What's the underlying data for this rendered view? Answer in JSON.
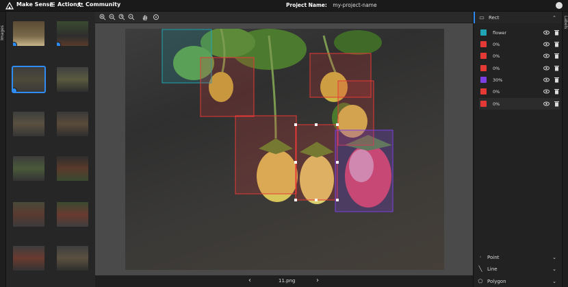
{
  "header": {
    "brand": "Make Sense",
    "nav": [
      {
        "label": "Actions",
        "icon": "actions-icon"
      },
      {
        "label": "Community",
        "icon": "community-icon"
      }
    ],
    "project_label": "Project Name:",
    "project_value": "my-project-name"
  },
  "left_panel": {
    "tab_label": "Images",
    "thumbnails": [
      {
        "checked": true,
        "selected": false
      },
      {
        "checked": true,
        "selected": false
      },
      {
        "checked": true,
        "selected": true
      },
      {
        "checked": false,
        "selected": false
      },
      {
        "checked": false,
        "selected": false
      },
      {
        "checked": false,
        "selected": false
      },
      {
        "checked": false,
        "selected": false
      },
      {
        "checked": false,
        "selected": false
      },
      {
        "checked": false,
        "selected": false
      },
      {
        "checked": false,
        "selected": false
      },
      {
        "checked": false,
        "selected": false
      },
      {
        "checked": false,
        "selected": false
      }
    ]
  },
  "toolbar": {
    "tools": [
      "zoom-in-icon",
      "zoom-out-icon",
      "zoom-fit-icon",
      "zoom-reset-icon",
      "hand-icon",
      "crosshair-icon"
    ]
  },
  "footer": {
    "filename": "11.png",
    "prev_icon": "chevron-left-icon",
    "next_icon": "chevron-right-icon"
  },
  "right_panel": {
    "tab_label": "Labels",
    "rect_section": {
      "title": "Rect",
      "labels": [
        {
          "text": "flower",
          "color": "#1fa5b5",
          "active": false
        },
        {
          "text": "0%",
          "color": "#e53935",
          "active": false
        },
        {
          "text": "0%",
          "color": "#e53935",
          "active": false
        },
        {
          "text": "0%",
          "color": "#e53935",
          "active": false
        },
        {
          "text": "30%",
          "color": "#7b3fe4",
          "active": false
        },
        {
          "text": "0%",
          "color": "#e53935",
          "active": false
        },
        {
          "text": "0%",
          "color": "#e53935",
          "active": true
        }
      ]
    },
    "collapsed_sections": [
      {
        "title": "Point",
        "icon": "point-icon"
      },
      {
        "title": "Line",
        "icon": "line-icon"
      },
      {
        "title": "Polygon",
        "icon": "polygon-icon"
      }
    ]
  },
  "colors": {
    "accent": "#2f8cf5",
    "flower_box": "#1fa5b5",
    "ripe0_box": "#e53935",
    "ripe30_box": "#7b3fe4"
  }
}
